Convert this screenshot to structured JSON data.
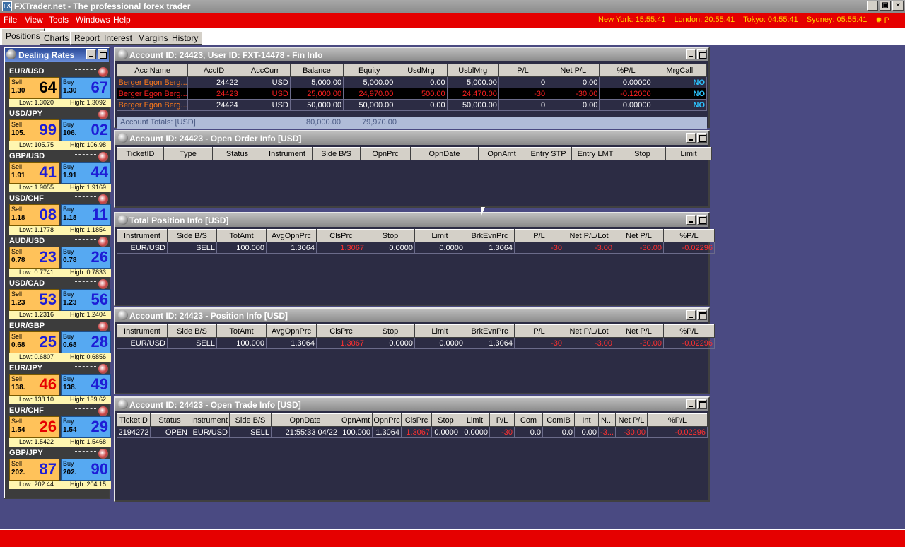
{
  "app": {
    "title": "FXTrader.net - The professional forex trader",
    "icon_label": "FX"
  },
  "window_buttons": {
    "minimize": "_",
    "restore": "▣",
    "close": "×"
  },
  "menu": [
    "File",
    "View",
    "Tools",
    "Windows",
    "Help"
  ],
  "clocks": {
    "ny": "New York: 15:55:41",
    "london": "London: 20:55:41",
    "tokyo": "Tokyo: 04:55:41",
    "sydney": "Sydney: 05:55:41",
    "sun_icon": "sun-icon",
    "tail": "P"
  },
  "tabs": [
    "Positions",
    "Charts",
    "Report",
    "Interest",
    "Margins",
    "History"
  ],
  "dealing": {
    "title": "Dealing Rates",
    "sell_label": "Sell",
    "buy_label": "Buy",
    "pairs": [
      {
        "name": "EUR/USD",
        "sell_base": "1.30",
        "sell_pips": "64",
        "buy_base": "1.30",
        "buy_pips": "67",
        "low": "Low: 1.3020",
        "high": "High: 1.3092",
        "sell_color": "#000000"
      },
      {
        "name": "USD/JPY",
        "sell_base": "105.",
        "sell_pips": "99",
        "buy_base": "106.",
        "buy_pips": "02",
        "low": "Low: 105.75",
        "high": "High: 106.98",
        "sell_color": "#1d1dd6"
      },
      {
        "name": "GBP/USD",
        "sell_base": "1.91",
        "sell_pips": "41",
        "buy_base": "1.91",
        "buy_pips": "44",
        "low": "Low: 1.9055",
        "high": "High: 1.9169",
        "sell_color": "#1d1dd6"
      },
      {
        "name": "USD/CHF",
        "sell_base": "1.18",
        "sell_pips": "08",
        "buy_base": "1.18",
        "buy_pips": "11",
        "low": "Low: 1.1778",
        "high": "High: 1.1854",
        "sell_color": "#1d1dd6"
      },
      {
        "name": "AUD/USD",
        "sell_base": "0.78",
        "sell_pips": "23",
        "buy_base": "0.78",
        "buy_pips": "26",
        "low": "Low: 0.7741",
        "high": "High: 0.7833",
        "sell_color": "#1d1dd6"
      },
      {
        "name": "USD/CAD",
        "sell_base": "1.23",
        "sell_pips": "53",
        "buy_base": "1.23",
        "buy_pips": "56",
        "low": "Low: 1.2316",
        "high": "High: 1.2404",
        "sell_color": "#1d1dd6"
      },
      {
        "name": "EUR/GBP",
        "sell_base": "0.68",
        "sell_pips": "25",
        "buy_base": "0.68",
        "buy_pips": "28",
        "low": "Low: 0.6807",
        "high": "High: 0.6856",
        "sell_color": "#1d1dd6"
      },
      {
        "name": "EUR/JPY",
        "sell_base": "138.",
        "sell_pips": "46",
        "buy_base": "138.",
        "buy_pips": "49",
        "low": "Low: 138.10",
        "high": "High: 139.62",
        "sell_color": "#e60000"
      },
      {
        "name": "EUR/CHF",
        "sell_base": "1.54",
        "sell_pips": "26",
        "buy_base": "1.54",
        "buy_pips": "29",
        "low": "Low: 1.5422",
        "high": "High: 1.5468",
        "sell_color": "#e60000"
      },
      {
        "name": "GBP/JPY",
        "sell_base": "202.",
        "sell_pips": "87",
        "buy_base": "202.",
        "buy_pips": "90",
        "low": "Low: 202.44",
        "high": "High: 204.15",
        "sell_color": "#1d1dd6"
      }
    ]
  },
  "fin_info": {
    "title": "Account ID: 24423, User ID: FXT-14478 - Fin Info",
    "columns": [
      "Acc Name",
      "AccID",
      "AccCurr",
      "Balance",
      "Equity",
      "UsdMrg",
      "UsblMrg",
      "P/L",
      "Net P/L",
      "%P/L",
      "MrgCall"
    ],
    "rows": [
      [
        "Berger Egon Berg...",
        "24422",
        "USD",
        "5,000.00",
        "5,000.00",
        "0.00",
        "5,000.00",
        "0",
        "0.00",
        "0.00000",
        "NO"
      ],
      [
        "Berger Egon Berg...",
        "24423",
        "USD",
        "25,000.00",
        "24,970.00",
        "500.00",
        "24,470.00",
        "-30",
        "-30.00",
        "-0.12000",
        "NO"
      ],
      [
        "Berger Egon Berg...",
        "24424",
        "USD",
        "50,000.00",
        "50,000.00",
        "0.00",
        "50,000.00",
        "0",
        "0.00",
        "0.00000",
        "NO"
      ]
    ],
    "totals_label": "Account Totals: [USD]",
    "totals_balance": "80,000.00",
    "totals_equity": "79,970.00"
  },
  "open_orders": {
    "title": "Account ID: 24423 - Open Order Info [USD]",
    "columns": [
      "TicketID",
      "Type",
      "Status",
      "Instrument",
      "Side B/S",
      "OpnPrc",
      "OpnDate",
      "OpnAmt",
      "Entry STP",
      "Entry LMT",
      "Stop",
      "Limit"
    ]
  },
  "total_position": {
    "title": "Total Position Info [USD]",
    "columns": [
      "Instrument",
      "Side B/S",
      "TotAmt",
      "AvgOpnPrc",
      "ClsPrc",
      "Stop",
      "Limit",
      "BrkEvnPrc",
      "P/L",
      "Net P/L/Lot",
      "Net P/L",
      "%P/L"
    ],
    "rows": [
      [
        "EUR/USD",
        "SELL",
        "100.000",
        "1.3064",
        "1.3067",
        "0.0000",
        "0.0000",
        "1.3064",
        "-30",
        "-3.00",
        "-30.00",
        "-0.02296"
      ]
    ]
  },
  "position_info": {
    "title": "Account ID: 24423 - Position Info [USD]",
    "columns": [
      "Instrument",
      "Side B/S",
      "TotAmt",
      "AvgOpnPrc",
      "ClsPrc",
      "Stop",
      "Limit",
      "BrkEvnPrc",
      "P/L",
      "Net P/L/Lot",
      "Net P/L",
      "%P/L"
    ],
    "rows": [
      [
        "EUR/USD",
        "SELL",
        "100.000",
        "1.3064",
        "1.3067",
        "0.0000",
        "0.0000",
        "1.3064",
        "-30",
        "-3.00",
        "-30.00",
        "-0.02296"
      ]
    ]
  },
  "open_trades": {
    "title": "Account ID: 24423 - Open Trade Info [USD]",
    "columns": [
      "TicketID",
      "Status",
      "Instrument",
      "Side B/S",
      "OpnDate",
      "OpnAmt",
      "OpnPrc",
      "ClsPrc",
      "Stop",
      "Limit",
      "P/L",
      "Com",
      "ComIB",
      "Int",
      "N...",
      "Net P/L",
      "%P/L"
    ],
    "rows": [
      [
        "2194272",
        "OPEN",
        "EUR/USD",
        "SELL",
        "21:55:33 04/22",
        "100.000",
        "1.3064",
        "1.3067",
        "0.0000",
        "0.0000",
        "-30",
        "0.0",
        "0.0",
        "0.00",
        "-3...",
        "-30.00",
        "-0.02296"
      ]
    ]
  }
}
